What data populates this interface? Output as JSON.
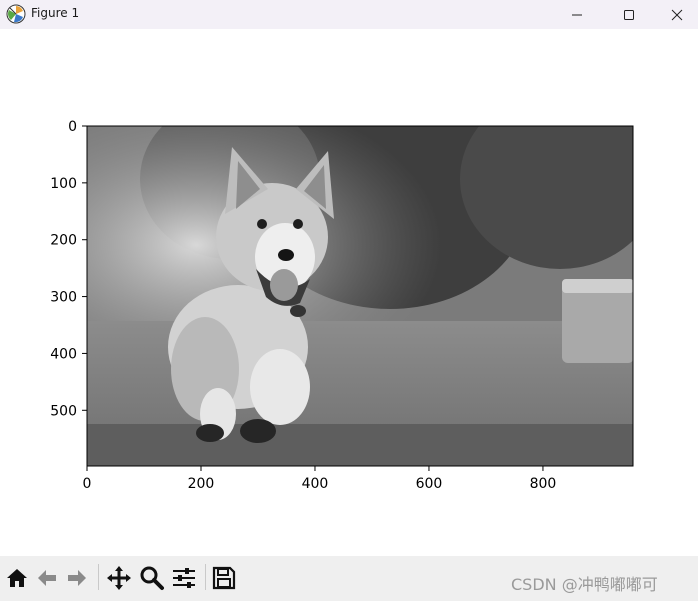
{
  "window": {
    "title": "Figure 1",
    "app_icon": "matplotlib-icon",
    "controls": [
      "minimize-icon",
      "maximize-icon",
      "close-icon"
    ]
  },
  "figure": {
    "image_description_icon": "corgi-grayscale-photo",
    "x_ticks": [
      "0",
      "200",
      "400",
      "600",
      "800"
    ],
    "y_ticks": [
      "0",
      "100",
      "200",
      "300",
      "400",
      "500"
    ],
    "image_extent": {
      "width": 958,
      "height": 598
    }
  },
  "toolbar": {
    "buttons": [
      {
        "icon": "home-icon"
      },
      {
        "icon": "back-arrow-icon"
      },
      {
        "icon": "forward-arrow-icon"
      },
      {
        "icon": "pan-icon"
      },
      {
        "icon": "zoom-icon"
      },
      {
        "icon": "configure-subplots-icon"
      },
      {
        "icon": "save-icon"
      }
    ],
    "watermark": "CSDN @冲鸭嘟嘟可"
  }
}
